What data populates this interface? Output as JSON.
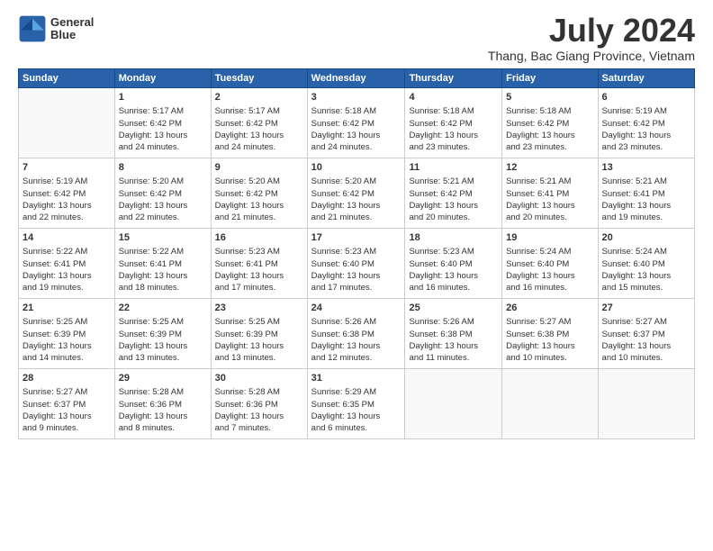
{
  "logo": {
    "line1": "General",
    "line2": "Blue"
  },
  "title": "July 2024",
  "subtitle": "Thang, Bac Giang Province, Vietnam",
  "days_of_week": [
    "Sunday",
    "Monday",
    "Tuesday",
    "Wednesday",
    "Thursday",
    "Friday",
    "Saturday"
  ],
  "weeks": [
    [
      {
        "day": "",
        "content": ""
      },
      {
        "day": "1",
        "content": "Sunrise: 5:17 AM\nSunset: 6:42 PM\nDaylight: 13 hours\nand 24 minutes."
      },
      {
        "day": "2",
        "content": "Sunrise: 5:17 AM\nSunset: 6:42 PM\nDaylight: 13 hours\nand 24 minutes."
      },
      {
        "day": "3",
        "content": "Sunrise: 5:18 AM\nSunset: 6:42 PM\nDaylight: 13 hours\nand 24 minutes."
      },
      {
        "day": "4",
        "content": "Sunrise: 5:18 AM\nSunset: 6:42 PM\nDaylight: 13 hours\nand 23 minutes."
      },
      {
        "day": "5",
        "content": "Sunrise: 5:18 AM\nSunset: 6:42 PM\nDaylight: 13 hours\nand 23 minutes."
      },
      {
        "day": "6",
        "content": "Sunrise: 5:19 AM\nSunset: 6:42 PM\nDaylight: 13 hours\nand 23 minutes."
      }
    ],
    [
      {
        "day": "7",
        "content": "Sunrise: 5:19 AM\nSunset: 6:42 PM\nDaylight: 13 hours\nand 22 minutes."
      },
      {
        "day": "8",
        "content": "Sunrise: 5:20 AM\nSunset: 6:42 PM\nDaylight: 13 hours\nand 22 minutes."
      },
      {
        "day": "9",
        "content": "Sunrise: 5:20 AM\nSunset: 6:42 PM\nDaylight: 13 hours\nand 21 minutes."
      },
      {
        "day": "10",
        "content": "Sunrise: 5:20 AM\nSunset: 6:42 PM\nDaylight: 13 hours\nand 21 minutes."
      },
      {
        "day": "11",
        "content": "Sunrise: 5:21 AM\nSunset: 6:42 PM\nDaylight: 13 hours\nand 20 minutes."
      },
      {
        "day": "12",
        "content": "Sunrise: 5:21 AM\nSunset: 6:41 PM\nDaylight: 13 hours\nand 20 minutes."
      },
      {
        "day": "13",
        "content": "Sunrise: 5:21 AM\nSunset: 6:41 PM\nDaylight: 13 hours\nand 19 minutes."
      }
    ],
    [
      {
        "day": "14",
        "content": "Sunrise: 5:22 AM\nSunset: 6:41 PM\nDaylight: 13 hours\nand 19 minutes."
      },
      {
        "day": "15",
        "content": "Sunrise: 5:22 AM\nSunset: 6:41 PM\nDaylight: 13 hours\nand 18 minutes."
      },
      {
        "day": "16",
        "content": "Sunrise: 5:23 AM\nSunset: 6:41 PM\nDaylight: 13 hours\nand 17 minutes."
      },
      {
        "day": "17",
        "content": "Sunrise: 5:23 AM\nSunset: 6:40 PM\nDaylight: 13 hours\nand 17 minutes."
      },
      {
        "day": "18",
        "content": "Sunrise: 5:23 AM\nSunset: 6:40 PM\nDaylight: 13 hours\nand 16 minutes."
      },
      {
        "day": "19",
        "content": "Sunrise: 5:24 AM\nSunset: 6:40 PM\nDaylight: 13 hours\nand 16 minutes."
      },
      {
        "day": "20",
        "content": "Sunrise: 5:24 AM\nSunset: 6:40 PM\nDaylight: 13 hours\nand 15 minutes."
      }
    ],
    [
      {
        "day": "21",
        "content": "Sunrise: 5:25 AM\nSunset: 6:39 PM\nDaylight: 13 hours\nand 14 minutes."
      },
      {
        "day": "22",
        "content": "Sunrise: 5:25 AM\nSunset: 6:39 PM\nDaylight: 13 hours\nand 13 minutes."
      },
      {
        "day": "23",
        "content": "Sunrise: 5:25 AM\nSunset: 6:39 PM\nDaylight: 13 hours\nand 13 minutes."
      },
      {
        "day": "24",
        "content": "Sunrise: 5:26 AM\nSunset: 6:38 PM\nDaylight: 13 hours\nand 12 minutes."
      },
      {
        "day": "25",
        "content": "Sunrise: 5:26 AM\nSunset: 6:38 PM\nDaylight: 13 hours\nand 11 minutes."
      },
      {
        "day": "26",
        "content": "Sunrise: 5:27 AM\nSunset: 6:38 PM\nDaylight: 13 hours\nand 10 minutes."
      },
      {
        "day": "27",
        "content": "Sunrise: 5:27 AM\nSunset: 6:37 PM\nDaylight: 13 hours\nand 10 minutes."
      }
    ],
    [
      {
        "day": "28",
        "content": "Sunrise: 5:27 AM\nSunset: 6:37 PM\nDaylight: 13 hours\nand 9 minutes."
      },
      {
        "day": "29",
        "content": "Sunrise: 5:28 AM\nSunset: 6:36 PM\nDaylight: 13 hours\nand 8 minutes."
      },
      {
        "day": "30",
        "content": "Sunrise: 5:28 AM\nSunset: 6:36 PM\nDaylight: 13 hours\nand 7 minutes."
      },
      {
        "day": "31",
        "content": "Sunrise: 5:29 AM\nSunset: 6:35 PM\nDaylight: 13 hours\nand 6 minutes."
      },
      {
        "day": "",
        "content": ""
      },
      {
        "day": "",
        "content": ""
      },
      {
        "day": "",
        "content": ""
      }
    ]
  ]
}
